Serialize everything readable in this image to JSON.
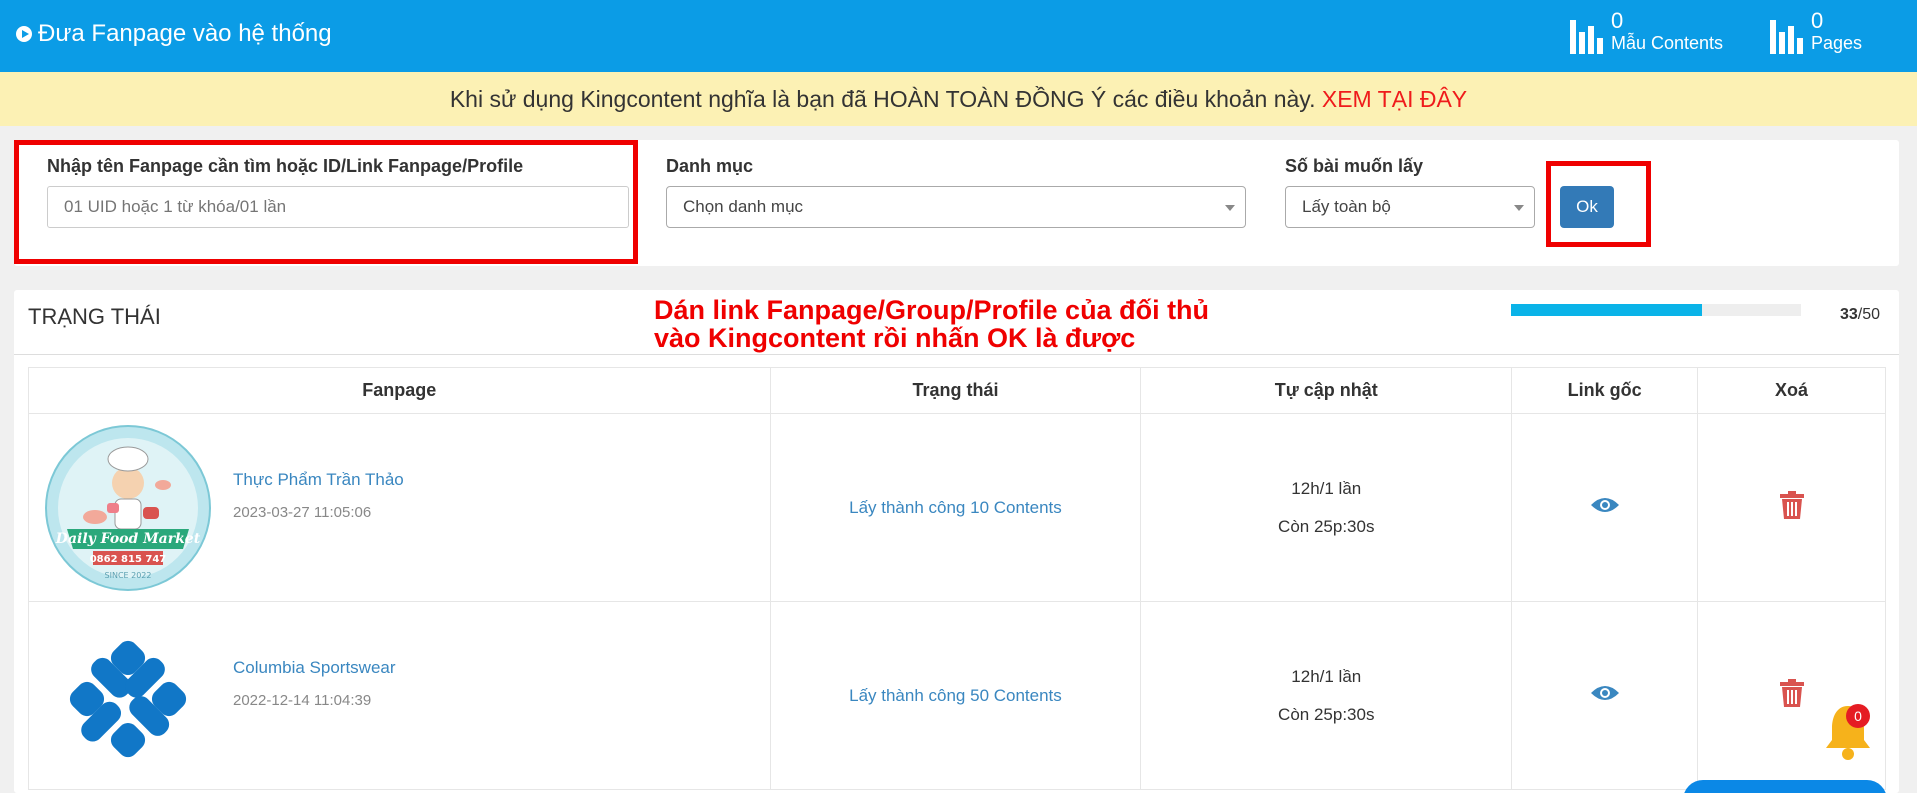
{
  "header": {
    "title": "Đưa Fanpage vào hệ thống",
    "stats": [
      {
        "count": "0",
        "label": "Mẫu Contents"
      },
      {
        "count": "0",
        "label": "Pages"
      }
    ]
  },
  "notice": {
    "text": "Khi sử dụng Kingcontent nghĩa là bạn đã HOÀN TOÀN ĐỒNG Ý các điều khoản này.",
    "link_label": "XEM TẠI ĐÂY"
  },
  "form": {
    "search_label": "Nhập tên Fanpage cần tìm hoặc ID/Link Fanpage/Profile",
    "search_placeholder": "01 UID hoặc 1 từ khóa/01 lần",
    "category_label": "Danh mục",
    "category_value": "Chọn danh mục",
    "count_label": "Số bài muốn lấy",
    "count_value": "Lấy toàn bộ",
    "ok_label": "Ok"
  },
  "status": {
    "title": "TRẠNG THÁI",
    "annotation": "Dán link Fanpage/Group/Profile của đối thủ\nvào Kingcontent rồi nhấn OK là được",
    "progress": {
      "current": "33",
      "total": "/50",
      "fraction": 0.66
    }
  },
  "table": {
    "headers": [
      "Fanpage",
      "Trạng thái",
      "Tự cập nhật",
      "Link gốc",
      "Xoá"
    ],
    "rows": [
      {
        "name": "Thực Phẩm Trần Thảo",
        "date": "2023-03-27 11:05:06",
        "status": "Lấy thành công 10 Contents",
        "update_freq": "12h/1 lần",
        "update_remaining": "Còn 25p:30s",
        "logo_text": "Daily Food Market",
        "logo_phone": "0862 815 747",
        "logo_since": "SINCE 2022"
      },
      {
        "name": "Columbia Sportswear",
        "date": "2022-12-14 11:04:39",
        "status": "Lấy thành công 50 Contents",
        "update_freq": "12h/1 lần",
        "update_remaining": "Còn 25p:30s"
      }
    ]
  },
  "notifications": {
    "count": "0"
  },
  "colors": {
    "header": "#0b9ce6",
    "notice_bg": "#fcf1b4",
    "accent_red": "#ef0000",
    "link_blue": "#3a87c0",
    "button_blue": "#337ab7",
    "delete_red": "#d9534f"
  },
  "icons": [
    "play-circle-icon",
    "bar-chart-icon",
    "eye-icon",
    "trash-icon",
    "bell-icon"
  ]
}
